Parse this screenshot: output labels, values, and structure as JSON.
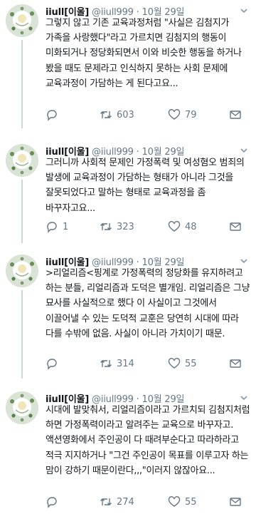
{
  "tweets": [
    {
      "name": "iiull[이울]",
      "handle": "@iiull999",
      "dot": "·",
      "date": "10월 29일",
      "text": "그렇지 않고 기존 교육과정처럼 \"사실은 김첨지가 가족을 사랑했다\"라고 가르치면 김첨지의 행동이 미화되거나 정당화되면서 이와 비슷한 행동을 하거나 봤을 때도 문제라고 인식하지 못하는 사회 문제에 교육과정이 가담하는 게 된다고요...",
      "replies": "",
      "retweets": "603",
      "likes": "79"
    },
    {
      "name": "iiull[이울]",
      "handle": "@iiull999",
      "dot": "·",
      "date": "10월 29일",
      "text": "그러니까 사회적 문제인 가정폭력 및 여성혐오 범죄의 발생에 교육과정이 가담하는 형태가 아니라 그것을 잘못되었다고 말하는 형태로 교육과정을 좀 바꾸자고요...",
      "replies": "1",
      "retweets": "323",
      "likes": "48"
    },
    {
      "name": "iiull[이울]",
      "handle": "@iiull999",
      "dot": "·",
      "date": "10월 29일",
      "text": ">리얼리즘<핑계로 가정폭력의 정당화를 유지하려고 하는 분들, 리얼리즘과 도덕은 별개임. 리얼리즘은 그냥 묘사를 사실적으로 했다 이 사실이고 그것에서 이끌어낼 수 있는 도덕적 교훈은 당연히 시대에 따라 다를 수밖에 없음. 사실이 아니라 가치이기 때문.",
      "replies": "",
      "retweets": "314",
      "likes": "55"
    },
    {
      "name": "iiull[이울]",
      "handle": "@iiull999",
      "dot": "·",
      "date": "10월 29일",
      "text": "시대에 발맞춰서, 리얼리즘이라고 가르치되 김첨지처럼 하면 가정폭력이라고 알려주는 교육으로 바꾸자고. 액션영화에서 주인공이 다 때려부순다고 따라하라고 적극 지지하거나 \"그건 주인공이 목표를 이루고자 하는 맘이 강하기 때문이란다,,,\"이러지 않잖아요...",
      "replies": "",
      "retweets": "274",
      "likes": "55"
    }
  ]
}
